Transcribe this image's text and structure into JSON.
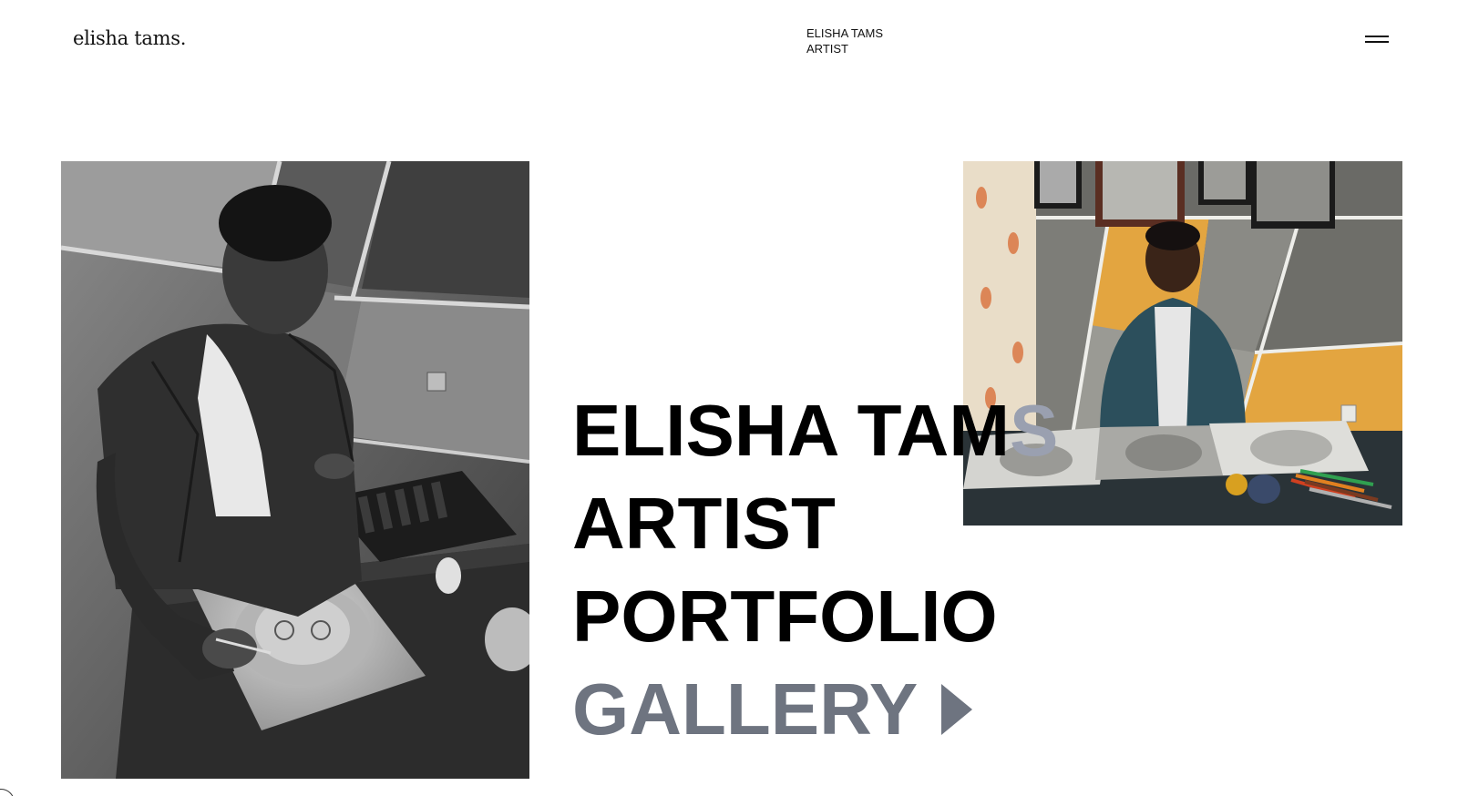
{
  "header": {
    "logo": "elisha tams.",
    "center_line1": "ELISHA TAMS",
    "center_line2": "ARTIST",
    "menu_icon": "hamburger-menu-icon"
  },
  "hero": {
    "line1_main": "ELISHA TAM",
    "line1_overlap": "S",
    "line2": "ARTIST",
    "line3": "PORTFOLIO",
    "gallery_label": "GALLERY",
    "gallery_icon": "play-arrow-icon"
  },
  "photos": {
    "left": "artist-drawing-bw-photo",
    "right": "artist-seated-with-drawings-photo"
  },
  "colors": {
    "background": "#ffffff",
    "text": "#000000",
    "gallery": "#6e7480",
    "overlap_text": "#9aa0b0"
  }
}
